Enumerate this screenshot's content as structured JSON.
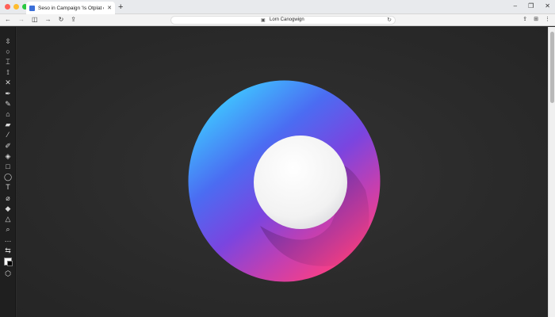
{
  "window": {
    "traffic_lights": [
      "#ff5f57",
      "#febc2e",
      "#28c840"
    ],
    "controls": [
      "–",
      "❐",
      "✕"
    ]
  },
  "tab": {
    "title": "Seso in Campaign 'Is Otplat enclt",
    "close": "✕",
    "new_tab": "+"
  },
  "toolbar": {
    "back": "←",
    "forward": "→",
    "sidebar_toggle": "◫",
    "reload_left": "↻",
    "share": "⇪",
    "url": "Lorn Canogwign",
    "reload": "↻",
    "right_tools": [
      "⇪",
      "⊞",
      "⋮"
    ]
  },
  "tools": [
    {
      "name": "move-tool",
      "glyph": "⇳"
    },
    {
      "name": "ellipse-select-tool",
      "glyph": "○"
    },
    {
      "name": "crop-tool",
      "glyph": "⌶"
    },
    {
      "name": "lasso-tool",
      "glyph": "⟟"
    },
    {
      "name": "transform-tool",
      "glyph": "✕"
    },
    {
      "name": "pen-tool",
      "glyph": "✒"
    },
    {
      "name": "fill-tool",
      "glyph": "✎"
    },
    {
      "name": "stamp-tool",
      "glyph": "⌂"
    },
    {
      "name": "eraser-tool",
      "glyph": "▰"
    },
    {
      "name": "eyedropper-tool",
      "glyph": "⁄"
    },
    {
      "name": "brush-tool",
      "glyph": "✐"
    },
    {
      "name": "patch-tool",
      "glyph": "◈"
    },
    {
      "name": "rectangle-tool",
      "glyph": "□"
    },
    {
      "name": "shape-tool",
      "glyph": "◯"
    },
    {
      "name": "text-tool",
      "glyph": "T"
    },
    {
      "name": "path-tool",
      "glyph": "⌀"
    },
    {
      "name": "paint-bucket-tool",
      "glyph": "◆"
    },
    {
      "name": "triangle-tool",
      "glyph": "△"
    },
    {
      "name": "zoom-tool",
      "glyph": "⌕"
    },
    {
      "name": "more-tools",
      "glyph": "…"
    },
    {
      "name": "swap-colors",
      "glyph": "⇆"
    }
  ],
  "colors": {
    "foreground": "#ffffff",
    "background": "#000000"
  },
  "artwork": {
    "gradient": [
      "#3fc4ff",
      "#4b6cf2",
      "#7a45e0",
      "#c43fb0",
      "#ff3f80"
    ],
    "inner_circle": "#f2f2f2"
  }
}
